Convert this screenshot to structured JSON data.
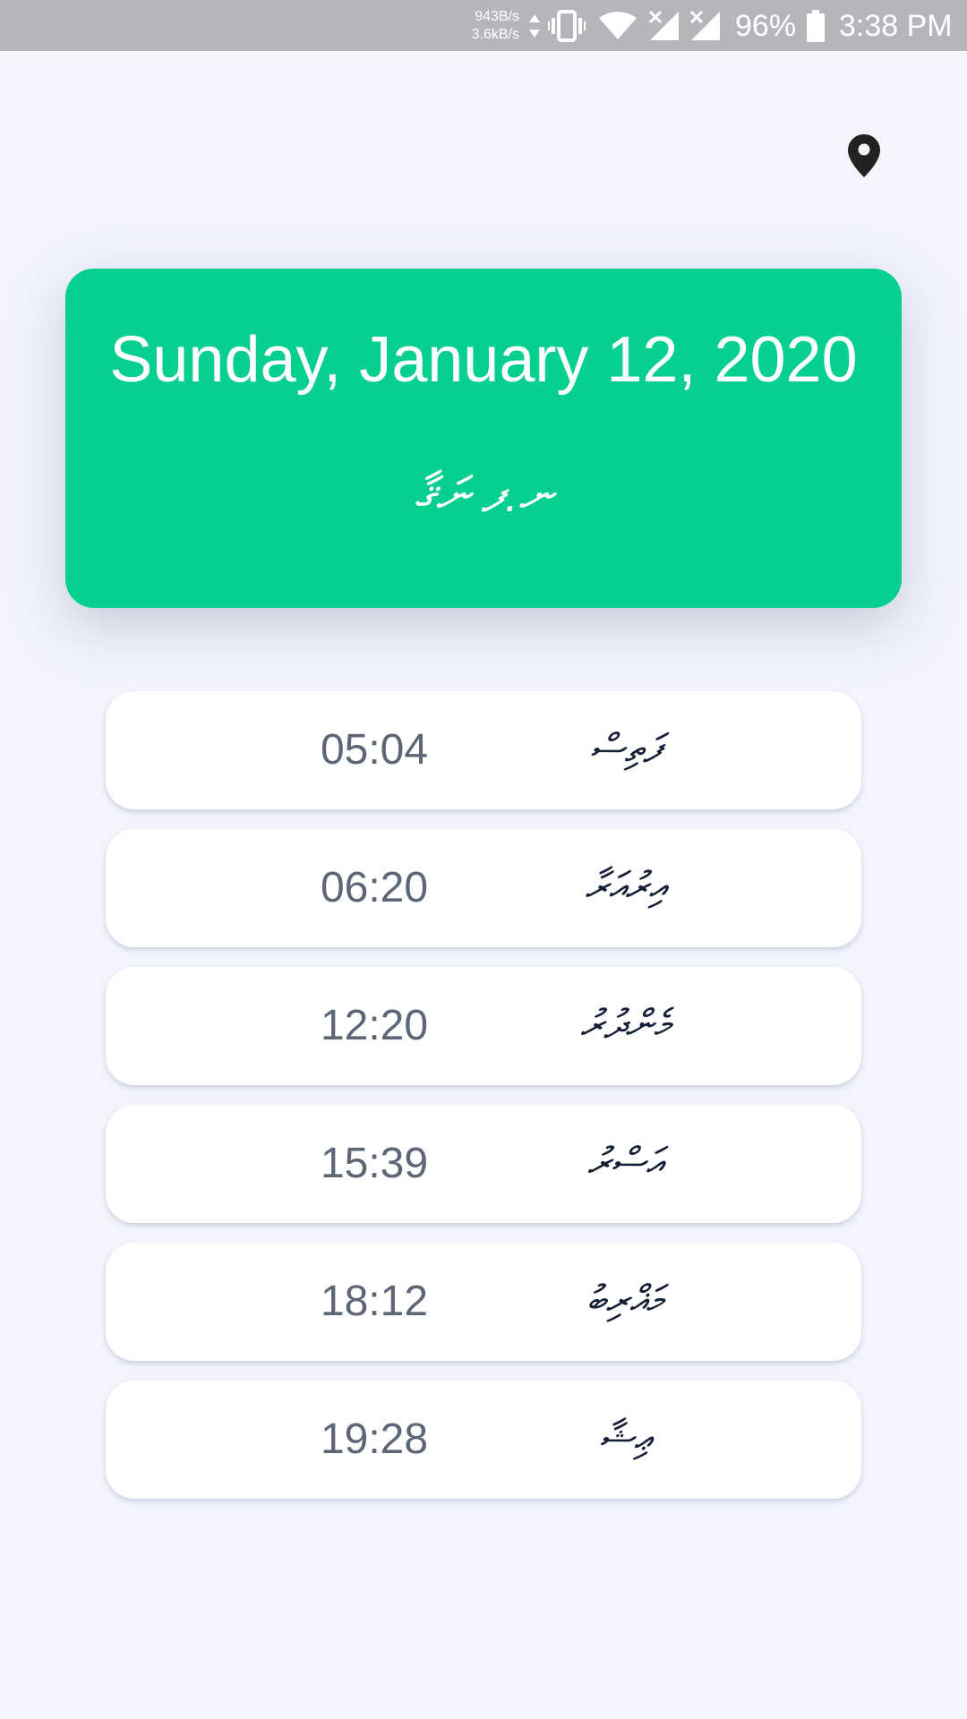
{
  "status_bar": {
    "net_speed_down": "943B/s",
    "net_speed_up": "3.6kB/s",
    "battery_percent": "96%",
    "time": "3:38 PM",
    "icons": [
      "data-arrows-icon",
      "vibrate-icon",
      "wifi-icon",
      "signal-no-sim-icon",
      "signal-no-sim-icon",
      "battery-icon"
    ]
  },
  "header": {
    "location_icon": "location-pin-icon"
  },
  "date_card": {
    "gregorian_date": "Sunday, January 12, 2020",
    "local_text": "ނ.ފ ނަޤާ",
    "background_color": "#07cf8f"
  },
  "prayers": [
    {
      "time": "05:04",
      "name": "ފަތިސް"
    },
    {
      "time": "06:20",
      "name": "އިރުއަރާ"
    },
    {
      "time": "12:20",
      "name": "މެންދުރު"
    },
    {
      "time": "15:39",
      "name": "އަސްރު"
    },
    {
      "time": "18:12",
      "name": "މަޣްރިބު"
    },
    {
      "time": "19:28",
      "name": "ޢިޝާ"
    }
  ]
}
